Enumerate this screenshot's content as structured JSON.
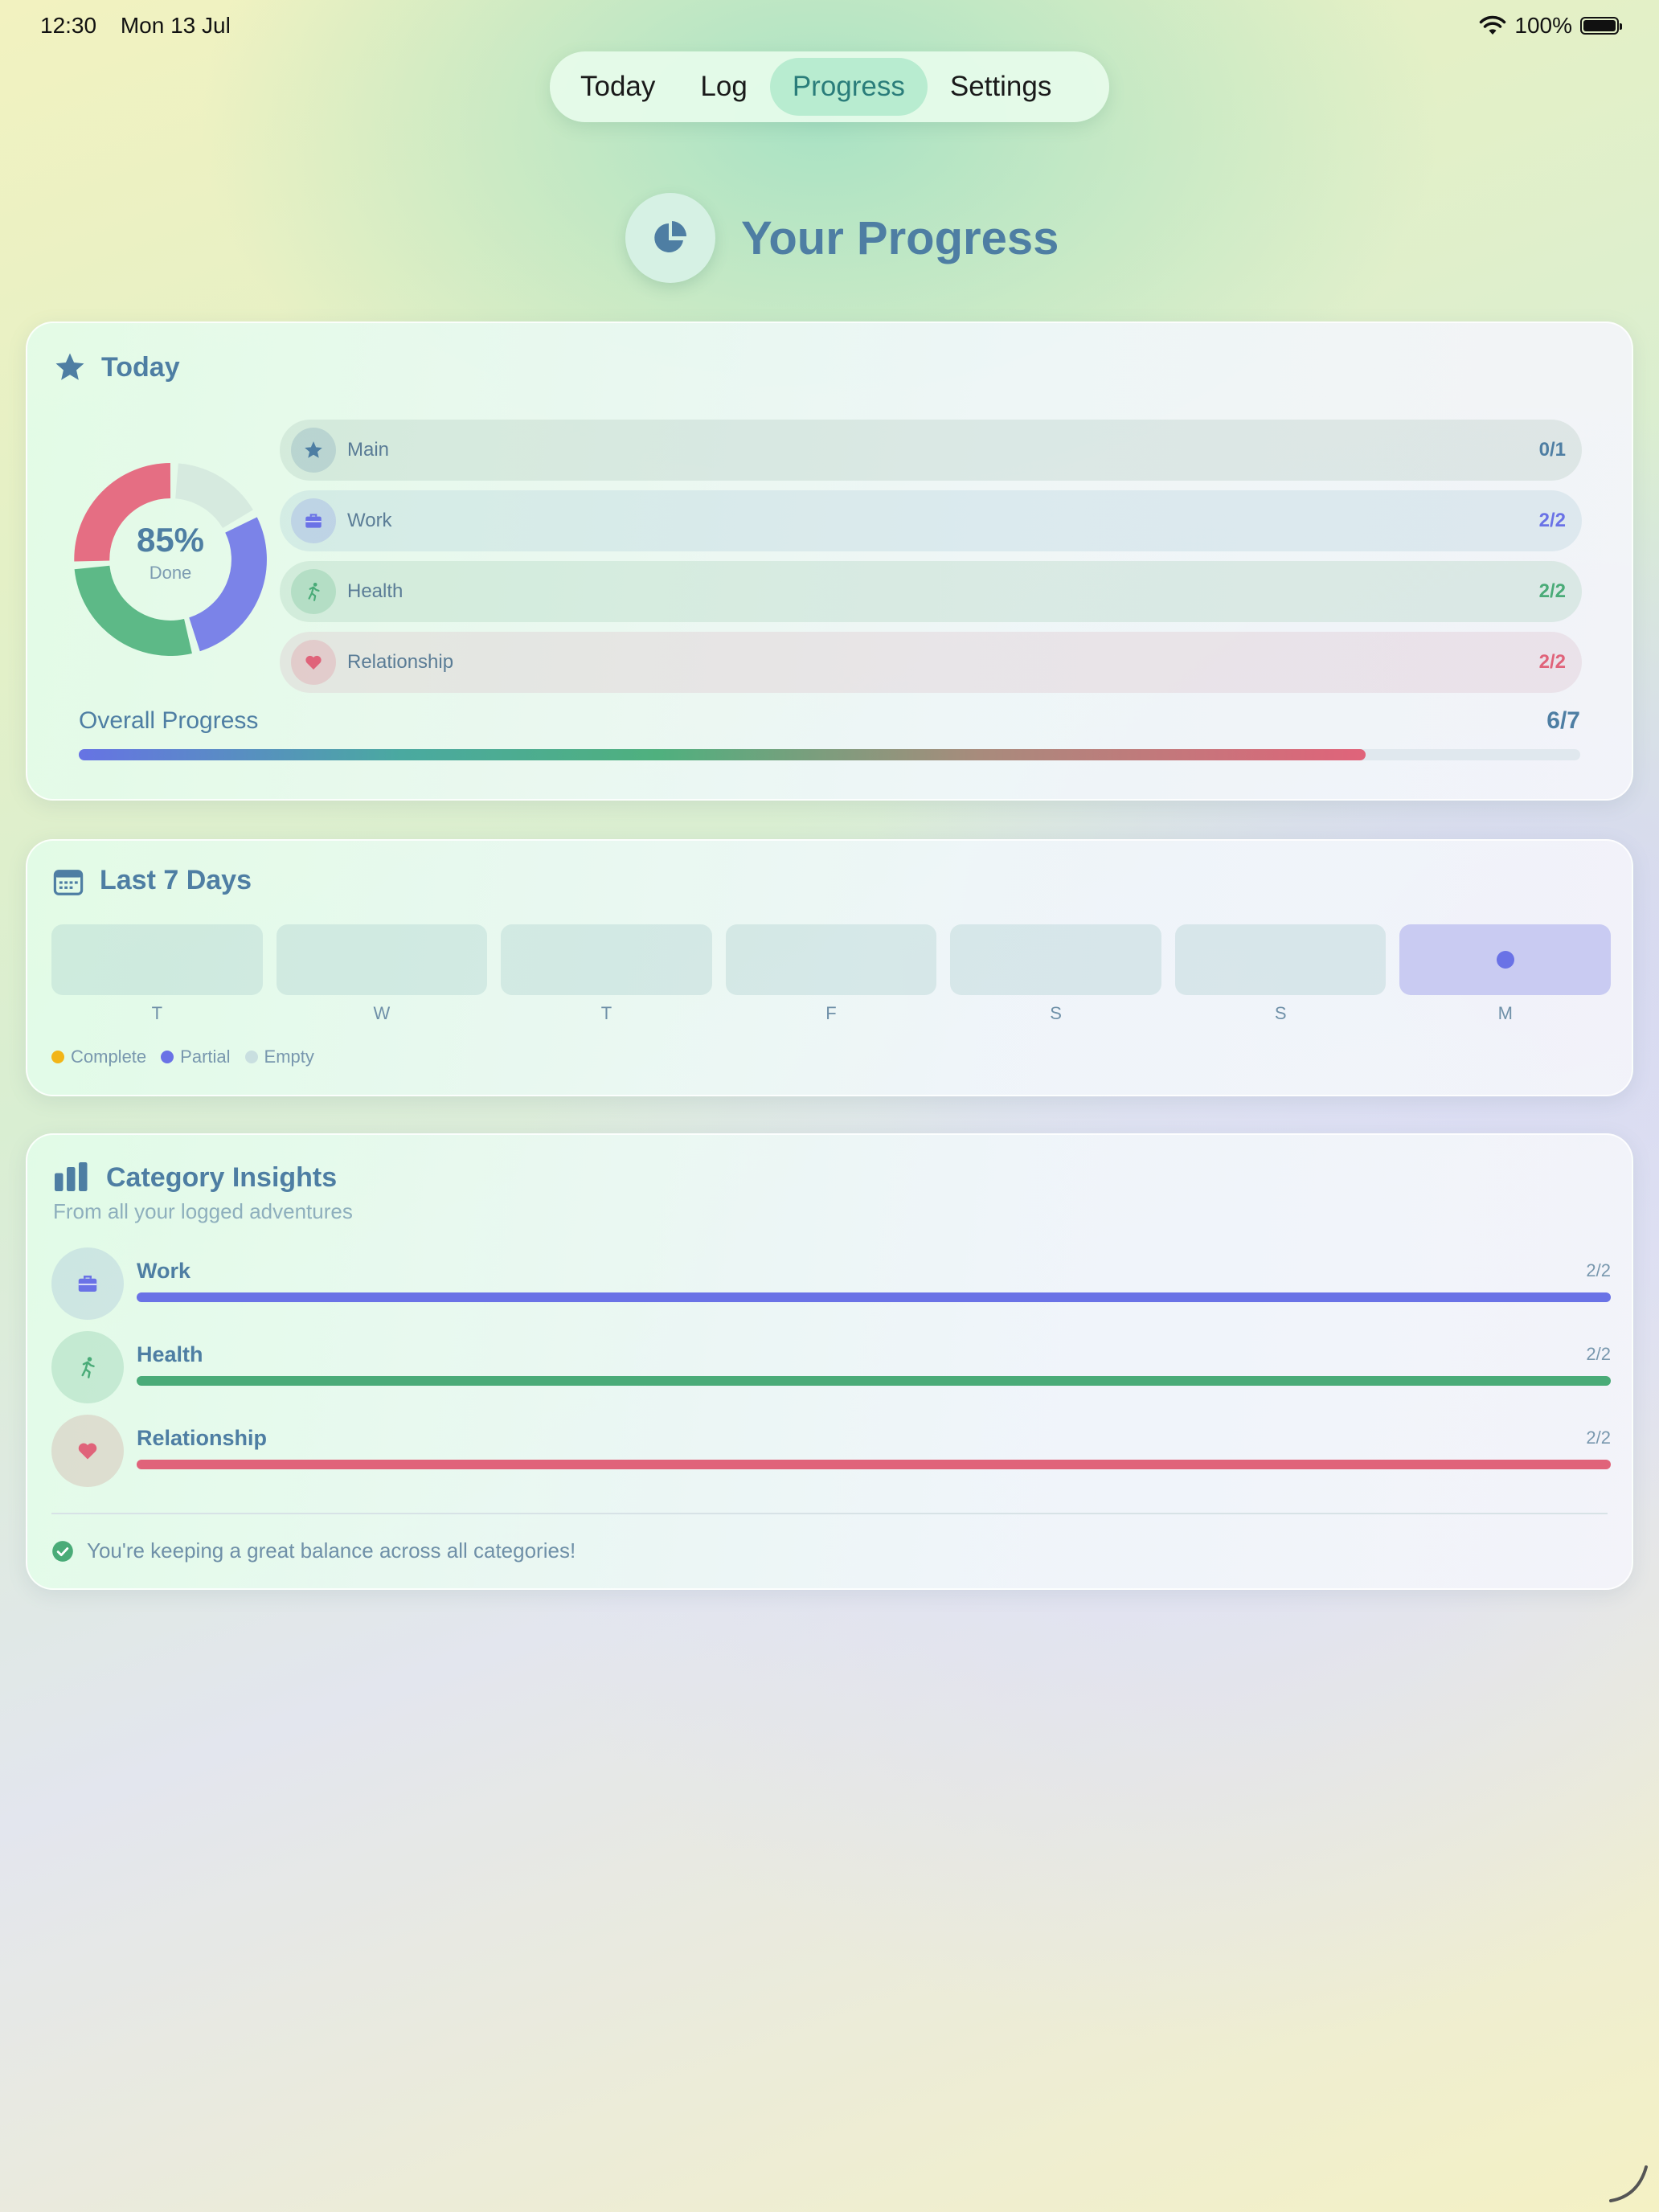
{
  "status_bar": {
    "time": "12:30",
    "date": "Mon 13 Jul",
    "battery": "100%"
  },
  "tabs": [
    {
      "label": "Today"
    },
    {
      "label": "Log"
    },
    {
      "label": "Progress"
    },
    {
      "label": "Settings"
    }
  ],
  "active_tab": "Progress",
  "page": {
    "title": "Your Progress",
    "icon": "pie-chart-icon"
  },
  "today": {
    "title": "Today",
    "donut": {
      "percent": "85%",
      "caption": "Done"
    },
    "categories": [
      {
        "label": "Main",
        "count": "0/1",
        "icon": "star-icon",
        "color": "#4e7ea3"
      },
      {
        "label": "Work",
        "count": "2/2",
        "icon": "briefcase-icon",
        "color": "#6a72e6"
      },
      {
        "label": "Health",
        "count": "2/2",
        "icon": "running-icon",
        "color": "#4aab78"
      },
      {
        "label": "Relationship",
        "count": "2/2",
        "icon": "heart-icon",
        "color": "#e0637a"
      }
    ],
    "overall": {
      "label": "Overall Progress",
      "count": "6/7",
      "fraction": 0.857
    }
  },
  "last7": {
    "title": "Last 7 Days",
    "days": [
      {
        "label": "T",
        "status": "empty"
      },
      {
        "label": "W",
        "status": "empty"
      },
      {
        "label": "T",
        "status": "empty"
      },
      {
        "label": "F",
        "status": "empty"
      },
      {
        "label": "S",
        "status": "empty"
      },
      {
        "label": "S",
        "status": "empty"
      },
      {
        "label": "M",
        "status": "partial"
      }
    ],
    "legend": [
      {
        "label": "Complete",
        "color": "#f2b517"
      },
      {
        "label": "Partial",
        "color": "#6a72e6"
      },
      {
        "label": "Empty",
        "color": "#c9dfe0"
      }
    ]
  },
  "insights": {
    "title": "Category Insights",
    "subtitle": "From all your logged adventures",
    "items": [
      {
        "label": "Work",
        "count": "2/2",
        "fraction": 1.0,
        "color": "#6a72e6",
        "icon": "briefcase-icon"
      },
      {
        "label": "Health",
        "count": "2/2",
        "fraction": 1.0,
        "color": "#4aab78",
        "icon": "running-icon"
      },
      {
        "label": "Relationship",
        "count": "2/2",
        "fraction": 1.0,
        "color": "#e0637a",
        "icon": "heart-icon"
      }
    ],
    "message": "You're keeping a great balance across all categories!"
  }
}
